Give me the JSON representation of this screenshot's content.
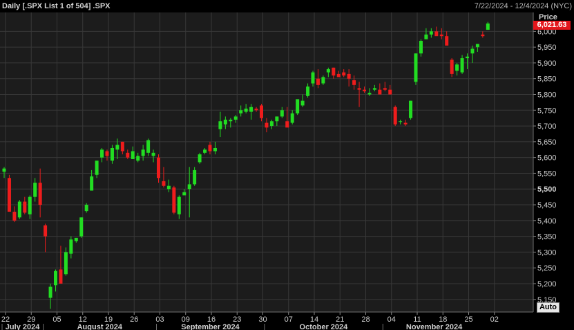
{
  "header": {
    "title": "Daily [.SPX List 1 of 504] .SPX",
    "date_range": "7/22/2024 - 12/4/2024 (NYC)",
    "price_label": "Price",
    "last_price": "6,021.63",
    "auto_label": "Auto"
  },
  "colors": {
    "background": "#1c1c1c",
    "grid": "#383838",
    "up": "#22dd22",
    "down": "#ee1c1c",
    "badge": "#e4161c"
  },
  "chart_data": {
    "type": "candlestick",
    "ylim": [
      5110,
      6060
    ],
    "y_ticks": [
      "5,150",
      "5,200",
      "5,250",
      "5,300",
      "5,350",
      "5,400",
      "5,450",
      "5,500",
      "5,550",
      "5,600",
      "5,650",
      "5,700",
      "5,750",
      "5,800",
      "5,850",
      "5,900",
      "5,950",
      "6,000"
    ],
    "y_tick_values": [
      5150,
      5200,
      5250,
      5300,
      5350,
      5400,
      5450,
      5500,
      5550,
      5600,
      5650,
      5700,
      5750,
      5800,
      5850,
      5900,
      5950,
      6000
    ],
    "bold_tick": "5,500",
    "x_day_labels": [
      "22",
      "29",
      "05",
      "12",
      "19",
      "26",
      "03",
      "09",
      "16",
      "23",
      "30",
      "07",
      "14",
      "21",
      "28",
      "04",
      "11",
      "18",
      "25",
      "02"
    ],
    "x_day_label_index": [
      0,
      5,
      10,
      15,
      20,
      25,
      30,
      35,
      40,
      45,
      50,
      55,
      60,
      65,
      70,
      75,
      80,
      85,
      90,
      95
    ],
    "months": [
      {
        "label": "July 2024",
        "start": 0,
        "end": 7
      },
      {
        "label": "August 2024",
        "start": 8,
        "end": 29
      },
      {
        "label": "September 2024",
        "start": 30,
        "end": 50
      },
      {
        "label": "October 2024",
        "start": 51,
        "end": 73
      },
      {
        "label": "November 2024",
        "start": 74,
        "end": 93
      }
    ],
    "candles": [
      [
        5555,
        5570,
        5535,
        5565
      ],
      [
        5535,
        5545,
        5450,
        5428
      ],
      [
        5428,
        5445,
        5395,
        5400
      ],
      [
        5410,
        5465,
        5405,
        5460
      ],
      [
        5460,
        5475,
        5420,
        5425
      ],
      [
        5420,
        5480,
        5405,
        5475
      ],
      [
        5475,
        5535,
        5460,
        5520
      ],
      [
        5520,
        5565,
        5410,
        5450
      ],
      [
        5385,
        5390,
        5300,
        5350
      ],
      [
        5155,
        5200,
        5120,
        5190
      ],
      [
        5195,
        5245,
        5175,
        5240
      ],
      [
        5245,
        5320,
        5200,
        5200
      ],
      [
        5230,
        5315,
        5225,
        5300
      ],
      [
        5295,
        5350,
        5280,
        5340
      ],
      [
        5335,
        5345,
        5330,
        5345
      ],
      [
        5350,
        5410,
        5345,
        5410
      ],
      [
        5430,
        5455,
        5425,
        5450
      ],
      [
        5495,
        5560,
        5495,
        5540
      ],
      [
        5545,
        5580,
        5535,
        5590
      ],
      [
        5600,
        5630,
        5585,
        5625
      ],
      [
        5620,
        5625,
        5590,
        5605
      ],
      [
        5590,
        5640,
        5580,
        5630
      ],
      [
        5625,
        5660,
        5595,
        5640
      ],
      [
        5650,
        5650,
        5610,
        5620
      ],
      [
        5615,
        5625,
        5595,
        5600
      ],
      [
        5595,
        5635,
        5600,
        5620
      ],
      [
        5590,
        5615,
        5585,
        5605
      ],
      [
        5605,
        5640,
        5590,
        5625
      ],
      [
        5615,
        5660,
        5605,
        5655
      ],
      [
        5605,
        5625,
        5585,
        5615
      ],
      [
        5600,
        5610,
        5520,
        5535
      ],
      [
        5525,
        5570,
        5505,
        5510
      ],
      [
        5500,
        5530,
        5490,
        5510
      ],
      [
        5505,
        5510,
        5420,
        5425
      ],
      [
        5420,
        5480,
        5405,
        5475
      ],
      [
        5480,
        5500,
        5480,
        5490
      ],
      [
        5500,
        5570,
        5410,
        5515
      ],
      [
        5515,
        5570,
        5510,
        5560
      ],
      [
        5585,
        5615,
        5580,
        5610
      ],
      [
        5615,
        5630,
        5610,
        5625
      ],
      [
        5640,
        5650,
        5610,
        5620
      ],
      [
        5620,
        5650,
        5610,
        5630
      ],
      [
        5690,
        5745,
        5665,
        5715
      ],
      [
        5705,
        5730,
        5690,
        5720
      ],
      [
        5715,
        5725,
        5695,
        5720
      ],
      [
        5720,
        5735,
        5710,
        5730
      ],
      [
        5740,
        5765,
        5730,
        5750
      ],
      [
        5745,
        5770,
        5740,
        5755
      ],
      [
        5745,
        5770,
        5720,
        5760
      ],
      [
        5755,
        5760,
        5745,
        5750
      ],
      [
        5765,
        5770,
        5715,
        5725
      ],
      [
        5710,
        5725,
        5680,
        5695
      ],
      [
        5700,
        5720,
        5690,
        5715
      ],
      [
        5715,
        5730,
        5700,
        5730
      ],
      [
        5730,
        5760,
        5725,
        5750
      ],
      [
        5715,
        5760,
        5700,
        5695
      ],
      [
        5710,
        5750,
        5705,
        5740
      ],
      [
        5740,
        5780,
        5735,
        5785
      ],
      [
        5765,
        5800,
        5760,
        5780
      ],
      [
        5795,
        5835,
        5790,
        5825
      ],
      [
        5835,
        5875,
        5825,
        5870
      ],
      [
        5850,
        5880,
        5820,
        5830
      ],
      [
        5835,
        5860,
        5830,
        5855
      ],
      [
        5870,
        5885,
        5855,
        5880
      ],
      [
        5885,
        5885,
        5850,
        5860
      ],
      [
        5865,
        5875,
        5855,
        5855
      ],
      [
        5870,
        5880,
        5855,
        5860
      ],
      [
        5865,
        5880,
        5825,
        5850
      ],
      [
        5845,
        5860,
        5815,
        5830
      ],
      [
        5820,
        5840,
        5760,
        5815
      ],
      [
        5815,
        5825,
        5805,
        5810
      ],
      [
        5800,
        5820,
        5795,
        5805
      ],
      [
        5815,
        5830,
        5810,
        5820
      ],
      [
        5815,
        5835,
        5810,
        5800
      ],
      [
        5820,
        5840,
        5810,
        5815
      ],
      [
        5815,
        5830,
        5800,
        5800
      ],
      [
        5760,
        5765,
        5700,
        5705
      ],
      [
        5715,
        5720,
        5705,
        5715
      ],
      [
        5710,
        5720,
        5700,
        5705
      ],
      [
        5725,
        5780,
        5720,
        5780
      ],
      [
        5840,
        5930,
        5830,
        5930
      ],
      [
        5930,
        5975,
        5920,
        5970
      ],
      [
        5975,
        6010,
        5975,
        5990
      ],
      [
        5990,
        6010,
        5980,
        6000
      ],
      [
        6000,
        6015,
        5990,
        5985
      ],
      [
        5990,
        6010,
        5975,
        5985
      ],
      [
        5985,
        6000,
        5960,
        5955
      ],
      [
        5910,
        5915,
        5855,
        5865
      ],
      [
        5875,
        5900,
        5860,
        5895
      ],
      [
        5870,
        5925,
        5865,
        5915
      ],
      [
        5915,
        5930,
        5880,
        5920
      ],
      [
        5930,
        5955,
        5900,
        5945
      ],
      [
        5950,
        5960,
        5935,
        5960
      ],
      [
        5990,
        6000,
        5980,
        5985
      ],
      [
        6005,
        6030,
        6005,
        6025
      ]
    ]
  }
}
